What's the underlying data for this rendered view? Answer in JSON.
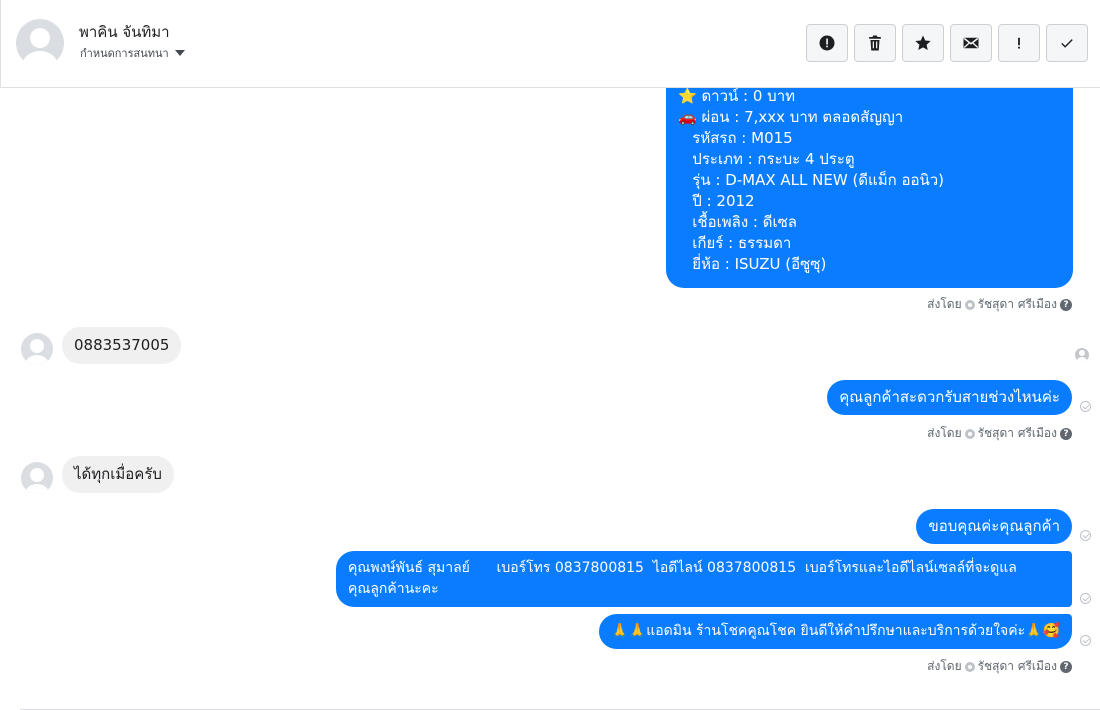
{
  "header": {
    "contact_name": "พาคิน จันทิมา",
    "assign_label": "กำหนดการสนทนา",
    "toolbar": {
      "spam": "spam-icon",
      "delete": "trash-icon",
      "star": "star-icon",
      "mark_unread": "envelope-icon",
      "follow_up": "exclamation-icon",
      "done": "check-icon"
    }
  },
  "messages": {
    "car_info_lines": [
      "⭐ ดาวน์ : 0 บาท",
      "🚗 ผ่อน : 7,xxx บาท ตลอดสัญญา",
      "   รหัสรถ : M015",
      "   ประเภท : กระบะ 4 ประตู",
      "   รุ่น : D-MAX ALL NEW (ดีแม็ก ออนิว)",
      "   ปี : 2012",
      "   เชื้อเพลิง : ดีเซล",
      "   เกียร์ : ธรรมดา",
      "   ยี่ห้อ : ISUZU (อีซูซุ)"
    ],
    "sent_by_prefix": "ส่งโดย",
    "sent_by_name": "รัชสุดา ศรีเมือง",
    "help_glyph": "?",
    "in_phone": "0883537005",
    "out_ask_time": "คุณลูกค้าสะดวกรับสายช่วงไหนค่ะ",
    "in_anytime": "ได้ทุกเมื่อครับ",
    "out_thanks": "ขอบคุณค่ะคุณลูกค้า",
    "out_contact_line1": "คุณพงษ์พันธ์ สุมาลย์      เบอร์โทร 0837800815  ไอดีไลน์ 0837800815  เบอร์โทรและไอดีไลน์เซลล์ที่จะดูแล",
    "out_contact_line2": "คุณลูกค้านะคะ",
    "out_admin": "🙏🙏แอดมิน ร้านโชคคูณโชค ยินดีให้คำปรึกษาและบริการด้วยใจค่ะ🙏🥰"
  }
}
